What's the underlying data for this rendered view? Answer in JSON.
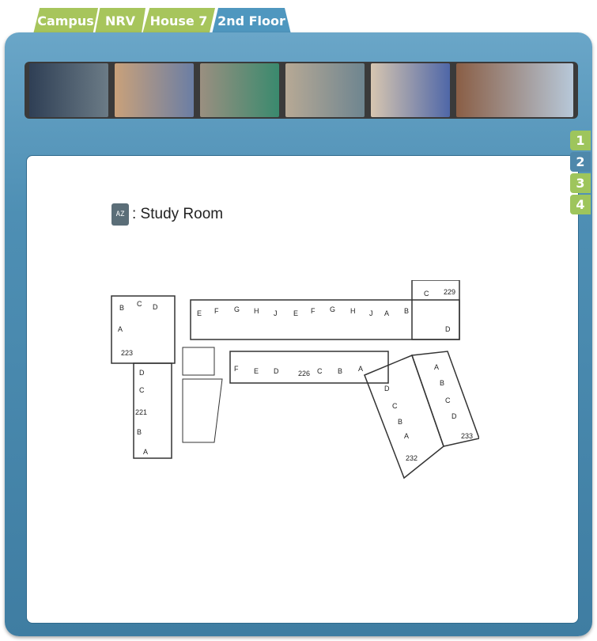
{
  "breadcrumbs": [
    {
      "label": "Campus",
      "active": false
    },
    {
      "label": "NRV",
      "active": false
    },
    {
      "label": "House 7",
      "active": false
    },
    {
      "label": "2nd Floor",
      "active": true
    }
  ],
  "photos": [
    {
      "name": "lobby-photo",
      "colors": [
        "#2f3f55",
        "#6b7b86"
      ]
    },
    {
      "name": "bedroom-photo",
      "colors": [
        "#c9a17a",
        "#6b7ea4"
      ]
    },
    {
      "name": "pool-room-photo",
      "colors": [
        "#9a8f80",
        "#3a8a6e"
      ]
    },
    {
      "name": "common-room-photo",
      "colors": [
        "#b7a995",
        "#6e8590"
      ]
    },
    {
      "name": "lounge-photo",
      "colors": [
        "#d7c6b0",
        "#4f67a8"
      ]
    },
    {
      "name": "building-exterior-photo",
      "colors": [
        "#8a5e45",
        "#b7c8d9"
      ]
    }
  ],
  "floor_tabs": [
    {
      "label": "1",
      "active": false
    },
    {
      "label": "2",
      "active": true
    },
    {
      "label": "3",
      "active": false
    },
    {
      "label": "4",
      "active": false
    }
  ],
  "legend": {
    "icon": "study-room-icon",
    "icon_text": "AZ",
    "label": ": Study Room"
  },
  "plan": {
    "labels": [
      "B",
      "C",
      "D",
      "A",
      "223",
      "D",
      "C",
      "221",
      "B",
      "A",
      "E",
      "F",
      "G",
      "H",
      "J",
      "E",
      "F",
      "G",
      "H",
      "J",
      "A",
      "B",
      "C",
      "229",
      "D",
      "F",
      "E",
      "D",
      "226",
      "C",
      "B",
      "A",
      "D",
      "C",
      "B",
      "A",
      "232",
      "A",
      "B",
      "C",
      "D",
      "233"
    ]
  }
}
